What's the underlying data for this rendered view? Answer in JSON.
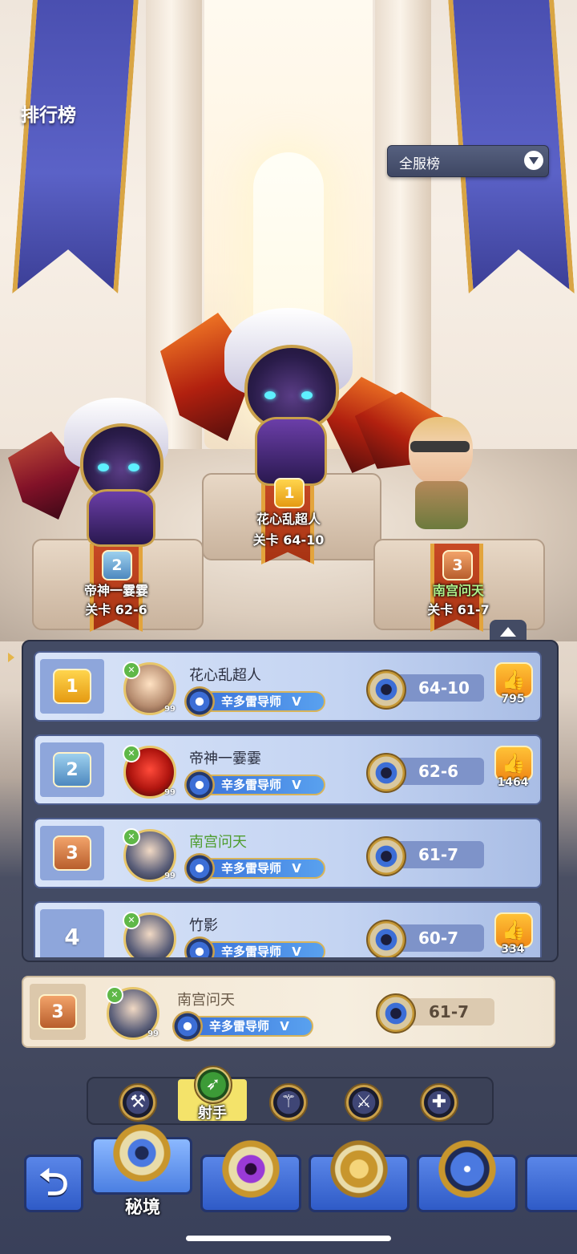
{
  "header": {
    "title": "排行榜",
    "server_filter": {
      "selected": "全服榜",
      "caret_icon": "chevron-down-icon"
    }
  },
  "podium": [
    {
      "rank": "1",
      "name": "花心乱超人",
      "stage_label": "关卡 64-10",
      "name_color": "#ffffff"
    },
    {
      "rank": "2",
      "name": "帝神一霎霎",
      "stage_label": "关卡 62-6",
      "name_color": "#ffffff"
    },
    {
      "rank": "3",
      "name": "南宫问天",
      "stage_label": "关卡 61-7",
      "name_color": "#aef08a"
    }
  ],
  "ranking_list": [
    {
      "rank": "1",
      "name": "花心乱超人",
      "level": "99",
      "guild": "辛多雷导师",
      "guild_rank": "V",
      "stage": "64-10",
      "likes": "795"
    },
    {
      "rank": "2",
      "name": "帝神一霎霎",
      "level": "99",
      "guild": "辛多雷导师",
      "guild_rank": "V",
      "stage": "62-6",
      "likes": "1464"
    },
    {
      "rank": "3",
      "name": "南宫问天",
      "level": "99",
      "guild": "辛多雷导师",
      "guild_rank": "V",
      "stage": "61-7",
      "likes": ""
    },
    {
      "rank": "4",
      "name": "竹影",
      "level": "",
      "guild": "辛多雷导师",
      "guild_rank": "V",
      "stage": "60-7",
      "likes": "334"
    }
  ],
  "my_rank": {
    "rank": "3",
    "name": "南宫问天",
    "level": "99",
    "guild": "辛多雷导师",
    "guild_rank": "V",
    "stage": "61-7"
  },
  "class_tabs": {
    "items": [
      {
        "icon": "axe-icon"
      },
      {
        "icon": "bow-icon",
        "label": "射手",
        "active": true
      },
      {
        "icon": "staff-icon"
      },
      {
        "icon": "sword-icon"
      },
      {
        "icon": "cross-icon"
      }
    ]
  },
  "bottom_nav": {
    "back_icon": "back-arrow-icon",
    "items": [
      {
        "label": "秘境",
        "icon": "eye-emblem-icon",
        "active": true
      },
      {
        "icon": "purple-gem-emblem-icon"
      },
      {
        "icon": "crown-emblem-icon"
      },
      {
        "icon": "star-compass-emblem-icon"
      }
    ]
  },
  "colors": {
    "accent_gold": "#e3a43c",
    "panel": "#434b64",
    "row_blue": "#c4d4f2",
    "my_row": "#f3e6d2"
  }
}
